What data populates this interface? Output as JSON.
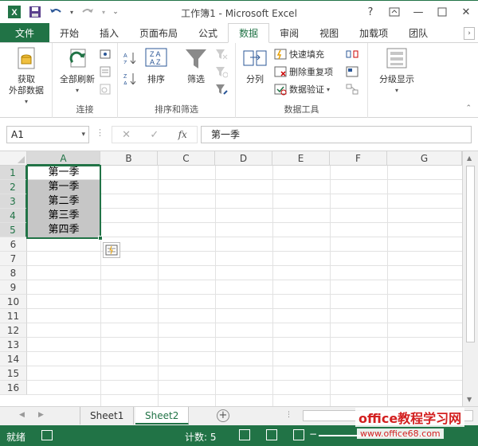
{
  "window": {
    "title": "工作簿1 - Microsoft Excel"
  },
  "ribbon_tabs": [
    "文件",
    "开始",
    "插入",
    "页面布局",
    "公式",
    "数据",
    "审阅",
    "视图",
    "加载项",
    "团队"
  ],
  "groups": {
    "connections": {
      "label": "连接",
      "get_external": "获取\n外部数据",
      "refresh_all": "全部刷新"
    },
    "sort_filter": {
      "label": "排序和筛选",
      "sort": "排序",
      "filter": "筛选"
    },
    "data_tools": {
      "label": "数据工具",
      "text_to_columns": "分列",
      "flash_fill": "快速填充",
      "remove_dup": "删除重复项",
      "validation": "数据验证"
    },
    "outline": {
      "outline_label": "分级显示"
    }
  },
  "formula_bar": {
    "name_box": "A1",
    "fx": "fx",
    "value": "第一季"
  },
  "columns": [
    "A",
    "B",
    "C",
    "D",
    "E",
    "F",
    "G"
  ],
  "rows": [
    "1",
    "2",
    "3",
    "4",
    "5",
    "6",
    "7",
    "8",
    "9",
    "10",
    "11",
    "12",
    "13",
    "14",
    "15",
    "16"
  ],
  "cells": [
    "第一季",
    "第一季",
    "第二季",
    "第三季",
    "第四季"
  ],
  "sheets": [
    "Sheet1",
    "Sheet2"
  ],
  "status": {
    "ready": "就绪",
    "count": "计数: 5"
  },
  "watermark": {
    "line1": "office教程学习网",
    "line2": "www.office68.com"
  },
  "colors": {
    "accent": "#217346",
    "selection": "#c6c6c6"
  }
}
